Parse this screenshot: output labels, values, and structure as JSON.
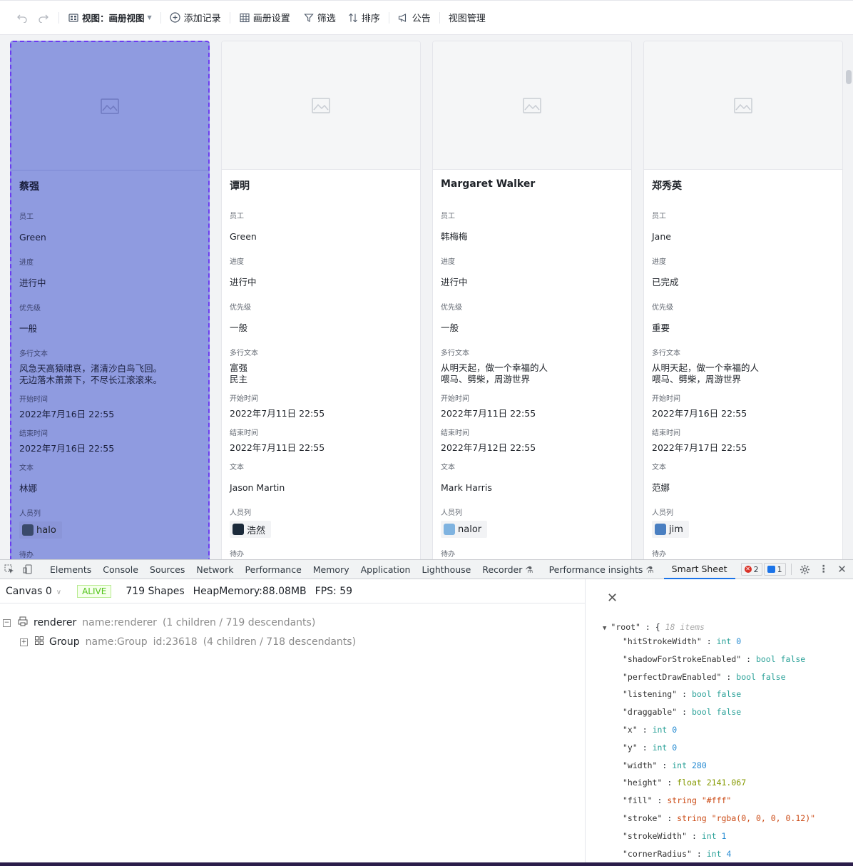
{
  "toolbar": {
    "undo_icon": "undo-icon",
    "redo_icon": "redo-icon",
    "view_label": "视图：画册视图",
    "add_record": "添加记录",
    "gallery_settings": "画册设置",
    "filter": "筛选",
    "sort": "排序",
    "announcement": "公告",
    "view_manage": "视图管理"
  },
  "field_labels": {
    "employee": "员工",
    "progress": "进度",
    "priority": "优先级",
    "multiline": "多行文本",
    "start": "开始时间",
    "end": "结束时间",
    "text": "文本",
    "people": "人员列",
    "todo": "待办"
  },
  "cards": [
    {
      "title": "蔡强",
      "employee": "Green",
      "progress": "进行中",
      "priority": "一般",
      "multiline_1": "风急天高猿啸哀，渚清沙白鸟飞回。",
      "multiline_2": "无边落木萧萧下，不尽长江滚滚来。",
      "start": "2022年7月16日 22:55",
      "end": "2022年7月16日 22:55",
      "text": "林娜",
      "person": "halo",
      "avatar_color": "#3a4a6b"
    },
    {
      "title": "谭明",
      "employee": "Green",
      "progress": "进行中",
      "priority": "一般",
      "multiline_1": "富强",
      "multiline_2": "民主",
      "start": "2022年7月11日 22:55",
      "end": "2022年7月11日 22:55",
      "text": "Jason Martin",
      "person": "浩然",
      "avatar_color": "#1b2a3a"
    },
    {
      "title": "Margaret Walker",
      "employee": "韩梅梅",
      "progress": "进行中",
      "priority": "一般",
      "multiline_1": "从明天起，做一个幸福的人",
      "multiline_2": "喂马、劈柴，周游世界",
      "start": "2022年7月11日 22:55",
      "end": "2022年7月12日 22:55",
      "text": "Mark Harris",
      "person": "nalor",
      "avatar_color": "#7fb3e0"
    },
    {
      "title": "郑秀英",
      "employee": "Jane",
      "progress": "已完成",
      "priority": "重要",
      "multiline_1": "从明天起，做一个幸福的人",
      "multiline_2": "喂马、劈柴，周游世界",
      "start": "2022年7月16日 22:55",
      "end": "2022年7月17日 22:55",
      "text": "范娜",
      "person": "jim",
      "avatar_color": "#4a7fc1"
    }
  ],
  "devtools": {
    "tabs": [
      "Elements",
      "Console",
      "Sources",
      "Network",
      "Performance",
      "Memory",
      "Application",
      "Lighthouse",
      "Recorder",
      "Performance insights",
      "Smart Sheet"
    ],
    "active_tab": "Smart Sheet",
    "error_count": "2",
    "message_count": "1",
    "canvas_select": "Canvas 0",
    "status": "ALIVE",
    "shapes": "719 Shapes",
    "heap": "HeapMemory:88.08MB",
    "fps": "FPS: 59",
    "tree": {
      "renderer_name": "renderer",
      "renderer_meta": "name:renderer",
      "renderer_count": "(1 children / 719 descendants)",
      "group_name": "Group",
      "group_meta": "name:Group",
      "group_id": "id:23618",
      "group_count": "(4 children / 718 descendants)"
    }
  },
  "inspector": {
    "root_key": "\"root\"",
    "root_count": "18 items",
    "props": [
      {
        "key": "\"hitStrokeWidth\"",
        "type": "int",
        "value": "0"
      },
      {
        "key": "\"shadowForStrokeEnabled\"",
        "type": "bool",
        "value": "false"
      },
      {
        "key": "\"perfectDrawEnabled\"",
        "type": "bool",
        "value": "false"
      },
      {
        "key": "\"listening\"",
        "type": "bool",
        "value": "false"
      },
      {
        "key": "\"draggable\"",
        "type": "bool",
        "value": "false"
      },
      {
        "key": "\"x\"",
        "type": "int",
        "value": "0"
      },
      {
        "key": "\"y\"",
        "type": "int",
        "value": "0"
      },
      {
        "key": "\"width\"",
        "type": "int",
        "value": "280"
      },
      {
        "key": "\"height\"",
        "type": "float",
        "value": "2141.067"
      },
      {
        "key": "\"fill\"",
        "type": "string",
        "value": "\"#fff\""
      },
      {
        "key": "\"stroke\"",
        "type": "string",
        "value": "\"rgba(0, 0, 0, 0.12)\""
      },
      {
        "key": "\"strokeWidth\"",
        "type": "int",
        "value": "1"
      },
      {
        "key": "\"cornerRadius\"",
        "type": "int",
        "value": "4"
      }
    ]
  }
}
